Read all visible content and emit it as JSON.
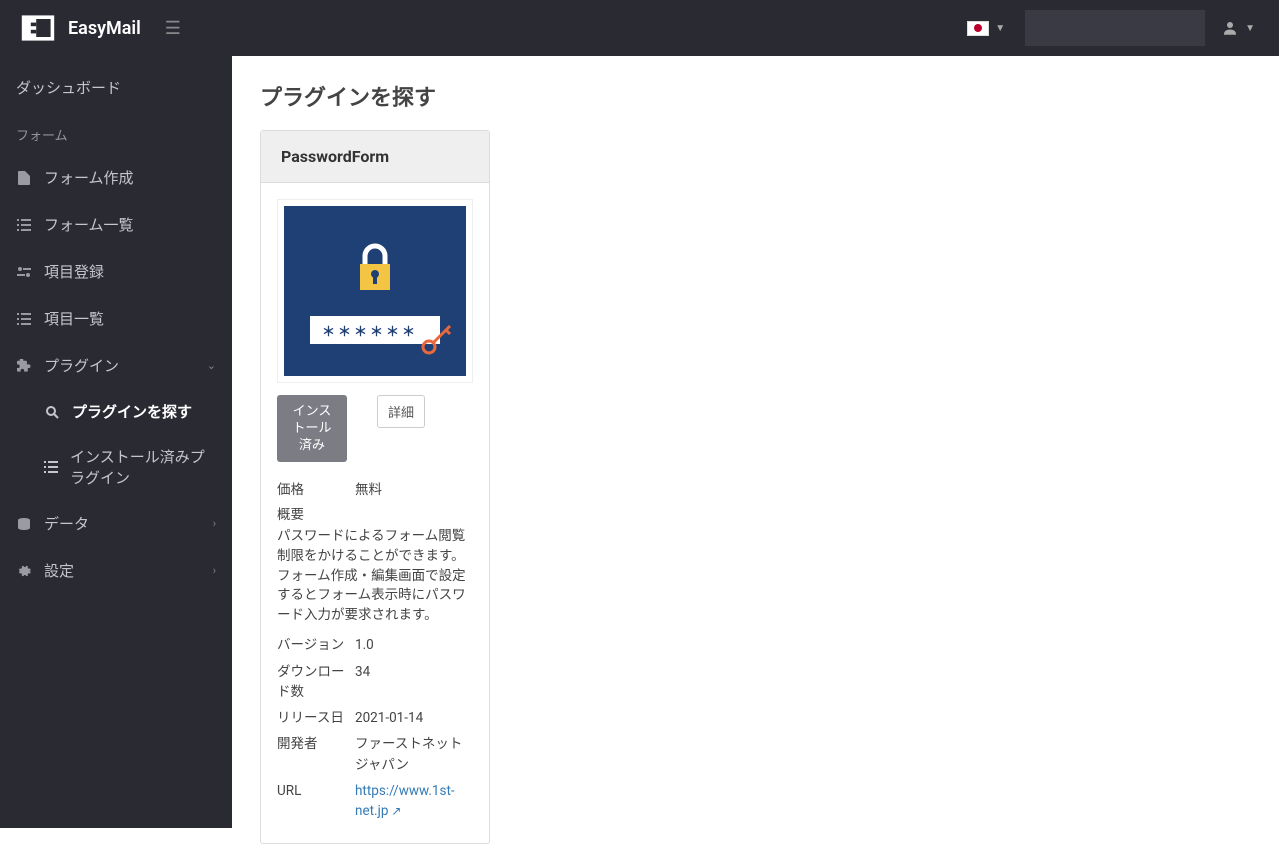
{
  "header": {
    "brand": "EasyMail"
  },
  "sidebar": {
    "dashboard": "ダッシュボード",
    "form_section": "フォーム",
    "form_create": "フォーム作成",
    "form_list": "フォーム一覧",
    "item_register": "項目登録",
    "item_list": "項目一覧",
    "plugin": "プラグイン",
    "plugin_search": "プラグインを探す",
    "plugin_installed": "インストール済みプラグイン",
    "data": "データ",
    "settings": "設定"
  },
  "page": {
    "title": "プラグインを探す"
  },
  "plugin_card": {
    "name": "PasswordForm",
    "thumb_mask": "＊＊＊＊＊＊",
    "btn_installed": "インストール済み",
    "btn_detail": "詳細",
    "labels": {
      "price": "価格",
      "overview": "概要",
      "version": "バージョン",
      "downloads": "ダウンロード数",
      "release": "リリース日",
      "developer": "開発者",
      "url": "URL"
    },
    "values": {
      "price": "無料",
      "overview_text": "パスワードによるフォーム閲覧制限をかけることができます。フォーム作成・編集画面で設定するとフォーム表示時にパスワード入力が要求されます。",
      "version": "1.0",
      "downloads": "34",
      "release": "2021-01-14",
      "developer": "ファーストネットジャパン",
      "url": "https://www.1st-net.jp"
    }
  }
}
